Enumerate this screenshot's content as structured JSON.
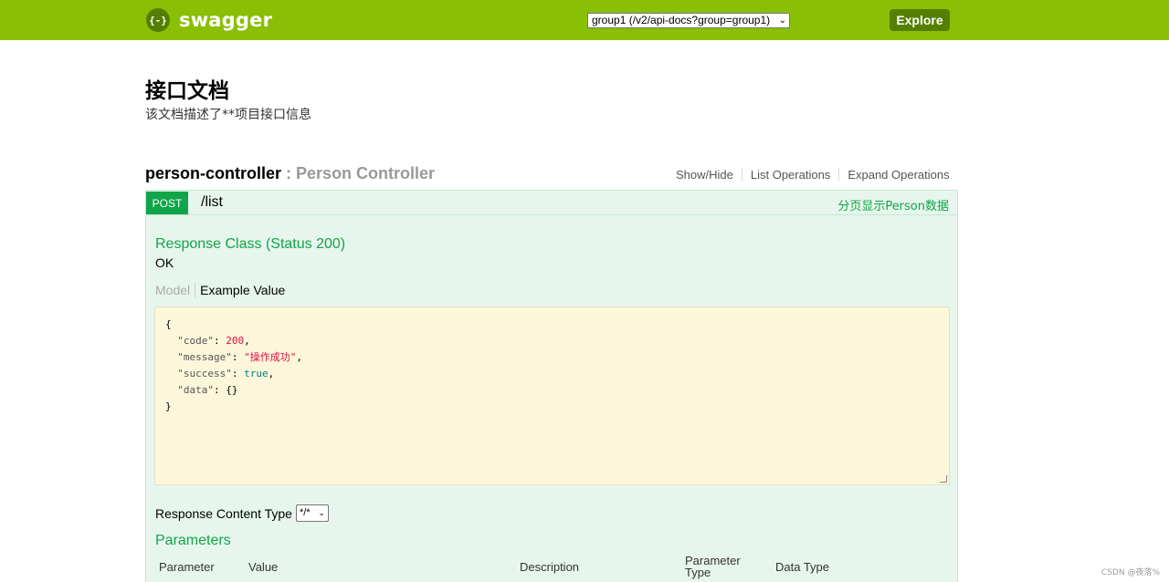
{
  "header": {
    "logo_icon": "{-}",
    "logo_text": "swagger",
    "api_select_value": "group1 (/v2/api-docs?group=group1)",
    "explore_label": "Explore",
    "bar_color": "#89bf04"
  },
  "info": {
    "title": "接口文档",
    "description": "该文档描述了**项目接口信息"
  },
  "resource": {
    "name": "person-controller",
    "separator": " : ",
    "description": "Person Controller",
    "links": [
      "Show/Hide",
      "List Operations",
      "Expand Operations"
    ]
  },
  "operation": {
    "method": "POST",
    "path": "/list",
    "summary": "分页显示Person数据",
    "response_class": "Response Class (Status 200)",
    "response_status": "OK",
    "tab_model": "Model",
    "tab_example": "Example Value",
    "example": {
      "open": "{",
      "code_key": "\"code\"",
      "code_val": "200",
      "message_key": "\"message\"",
      "message_val": "\"操作成功\"",
      "success_key": "\"success\"",
      "success_val": "true",
      "data_key": "\"data\"",
      "data_val": "{}",
      "close": "}"
    },
    "response_content_type_label": "Response Content Type",
    "response_content_type_value": "*/*",
    "parameters_heading": "Parameters",
    "param_columns": [
      "Parameter",
      "Value",
      "Description",
      "Parameter Type",
      "Data Type"
    ]
  },
  "watermark": "CSDN @夜落%"
}
